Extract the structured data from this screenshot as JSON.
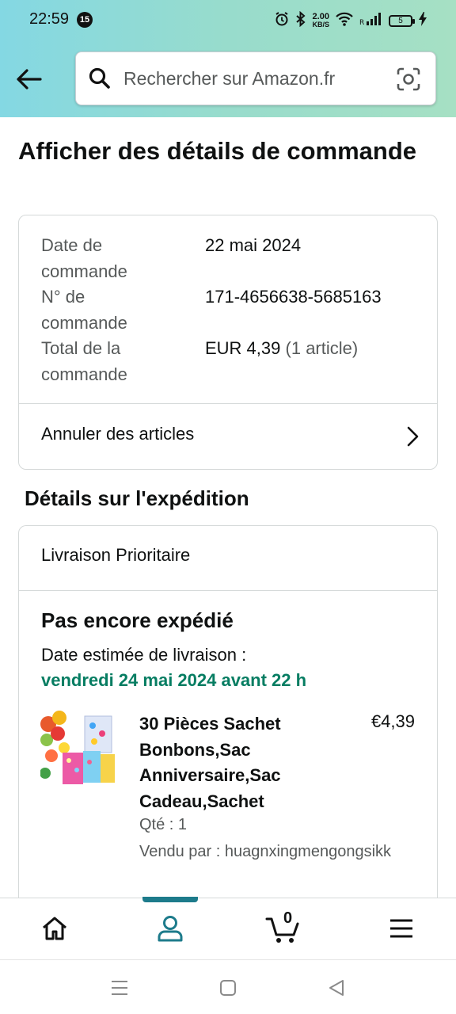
{
  "status_bar": {
    "time": "22:59",
    "notification_count": "15",
    "speed_value": "2.00",
    "speed_unit": "KB/S",
    "battery": "5"
  },
  "search": {
    "placeholder": "Rechercher sur Amazon.fr"
  },
  "page": {
    "title": "Afficher des détails de commande"
  },
  "summary": {
    "order_date_label": "Date de commande",
    "order_date": "22 mai 2024",
    "order_number_label": "N° de commande",
    "order_number": "171-4656638-5685163",
    "total_label": "Total de la commande",
    "total_value": "EUR 4,39",
    "total_items": "(1 article)",
    "cancel_label": "Annuler des articles"
  },
  "shipping": {
    "section_title": "Détails sur l'expédition",
    "method": "Livraison Prioritaire",
    "status": "Pas encore expédié",
    "estimate_label": "Date estimée de livraison :",
    "estimate_date": "vendredi 24 mai 2024 avant 22 h",
    "item": {
      "title": "30 Pièces Sachet Bonbons,Sac Anniversaire,Sac Cadeau,Sachet",
      "price": "€4,39",
      "qty": "Qté : 1",
      "seller": "Vendu par : huagnxingmengongsikk"
    }
  },
  "bottom_nav": {
    "active": "account",
    "cart_count": "0",
    "accent_color": "#1d7b8b"
  },
  "colors": {
    "delivery_green": "#067d62",
    "muted_text": "#565959"
  }
}
